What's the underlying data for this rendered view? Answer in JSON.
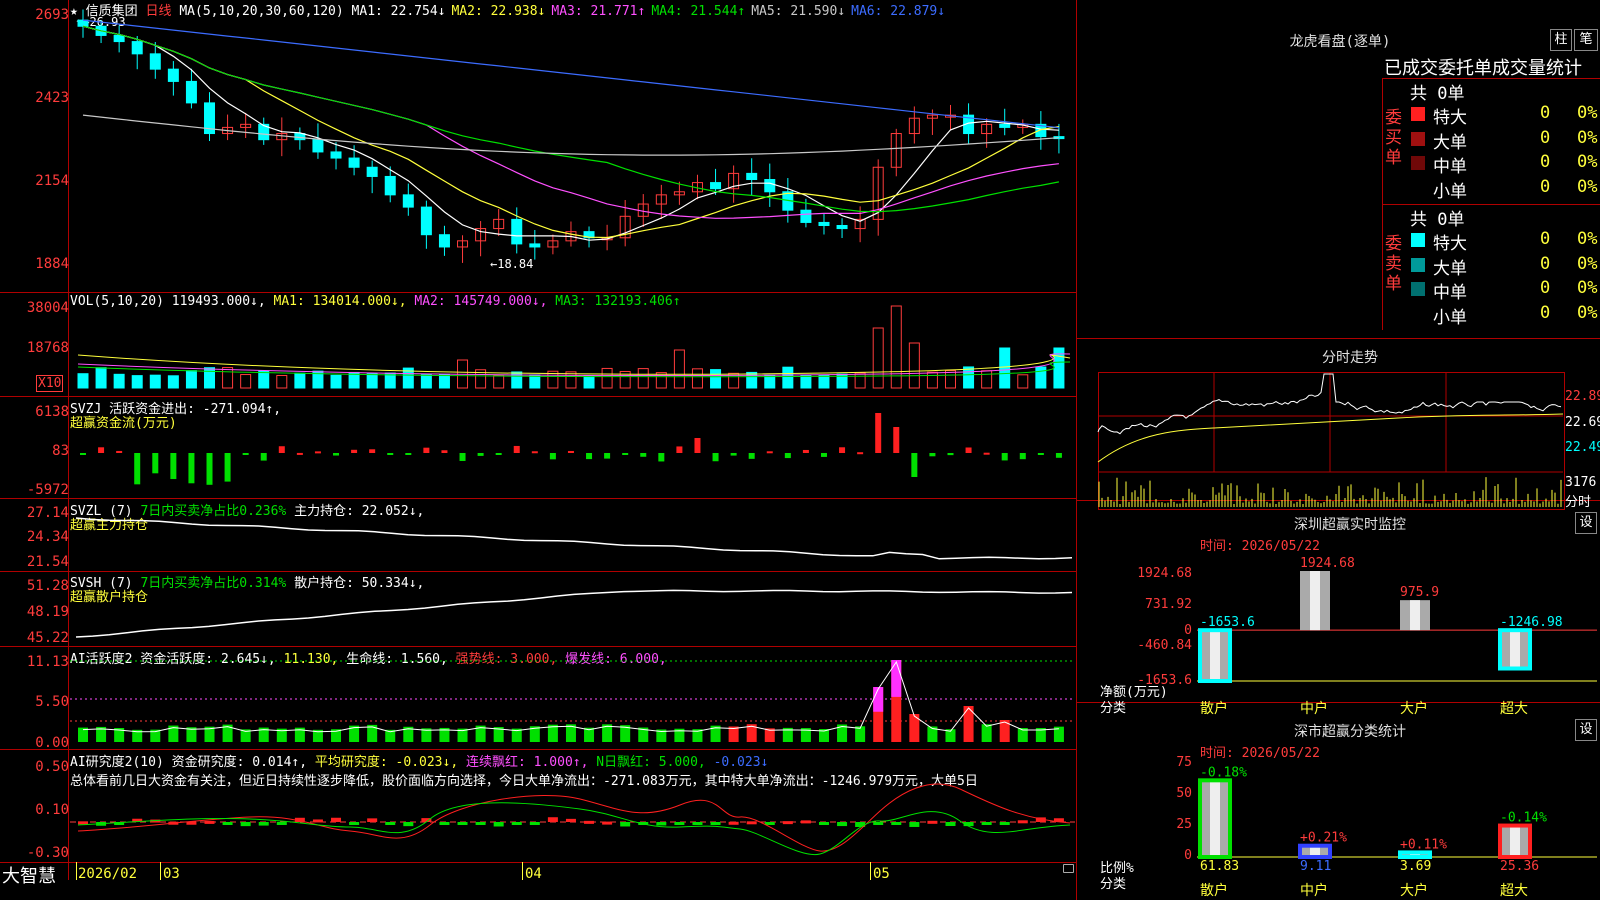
{
  "stock": {
    "star": "★",
    "name": "信质集团",
    "period": "日线"
  },
  "ma_legend": {
    "label": "MA(5,10,20,30,60,120)",
    "items": [
      {
        "name": "MA1:",
        "value": "22.754",
        "arrow": "↓",
        "color": "#ffffff"
      },
      {
        "name": "MA2:",
        "value": "22.938",
        "arrow": "↓",
        "color": "#ffff3c"
      },
      {
        "name": "MA3:",
        "value": "21.771",
        "arrow": "↑",
        "color": "#ff50ff"
      },
      {
        "name": "MA4:",
        "value": "21.544",
        "arrow": "↑",
        "color": "#00e000"
      },
      {
        "name": "MA5:",
        "value": "21.590",
        "arrow": "↓",
        "color": "#c8c8c8"
      },
      {
        "name": "MA6:",
        "value": "22.879",
        "arrow": "↓",
        "color": "#3c6cff"
      }
    ]
  },
  "price_axis": [
    "2693",
    "2423",
    "2154",
    "1884"
  ],
  "annot_high": "26.93",
  "annot_low": "←18.84",
  "vol": {
    "axis": [
      "38004",
      "18768"
    ],
    "x10": "X10",
    "head": "VOL(5,10,20)",
    "value": "119493.000",
    "ma1": "MA1: 134014.000↓,",
    "ma2": "MA2: 145749.000↓,",
    "ma3": "MA3: 132193.406↑"
  },
  "svzj": {
    "axis": [
      "6138",
      "83",
      "-5972"
    ],
    "head": "SVZJ  活跃资金进出: -271.094↑,",
    "sub": "超赢资金流(万元)"
  },
  "svzl": {
    "axis": [
      "27.14",
      "24.34",
      "21.54"
    ],
    "head1": "SVZL (7)",
    "head2": "7日内买卖净占比0.236%",
    "head3": "主力持仓: 22.052↓,",
    "sub": "超赢主力持仓"
  },
  "svsh": {
    "axis": [
      "51.28",
      "48.19",
      "45.22"
    ],
    "head1": "SVSH (7)",
    "head2": "7日内买卖净占比0.314%",
    "head3": "散户持仓: 50.334↓,",
    "sub": "超赢散户持仓"
  },
  "ai_active": {
    "axis": [
      "11.13",
      "5.50",
      "0.00"
    ],
    "h1": "AI活跃度2 资金活跃度: 2.645↓,",
    "h2": "11.130,",
    "h3": "生命线: 1.560,",
    "h4": "强势线: 3.000,",
    "h5": "爆发线: 6.000,"
  },
  "ai_research": {
    "axis": [
      "0.50",
      "0.10",
      "-0.30"
    ],
    "h1": "AI研究度2(10) 资金研究度: 0.014↑,",
    "h2": "平均研究度: -0.023↓,",
    "h3": "连续飘红: 1.000↑,",
    "h4": "N日飘红: 5.000,",
    "h5": "-0.023↓",
    "summary": "总体看前几日大资金有关注，但近日持续性逐步降低，股价面临方向选择，今日大单净流出：-271.083万元，其中特大单净流出：-1246.979万元，大单5日"
  },
  "footer": {
    "brand": "大智慧",
    "dates": [
      "2026/02",
      "03",
      "04",
      "05"
    ]
  },
  "dragon": {
    "title": "龙虎看盘(逐单)",
    "btn1": "柱",
    "btn2": "笔",
    "heading": "已成交委托单成交量统计",
    "buy_label": "委买单",
    "sell_label": "委卖单",
    "buy_total": "共 0单",
    "sell_total": "共 0单",
    "buy_rows": [
      {
        "label": "特大",
        "count": "0",
        "pct": "0%",
        "color": "#ff2020"
      },
      {
        "label": "大单",
        "count": "0",
        "pct": "0%",
        "color": "#a01010"
      },
      {
        "label": "中单",
        "count": "0",
        "pct": "0%",
        "color": "#700808"
      },
      {
        "label": "小单",
        "count": "0",
        "pct": "0%",
        "color": "#000000"
      }
    ],
    "sell_rows": [
      {
        "label": "特大",
        "count": "0",
        "pct": "0%",
        "color": "#00ffff"
      },
      {
        "label": "大单",
        "count": "0",
        "pct": "0%",
        "color": "#009a9a"
      },
      {
        "label": "中单",
        "count": "0",
        "pct": "0%",
        "color": "#007070"
      },
      {
        "label": "小单",
        "count": "0",
        "pct": "0%",
        "color": "#000000"
      }
    ]
  },
  "intraday": {
    "title": "分时走势",
    "axis": [
      "22.89",
      "22.69",
      "22.49"
    ],
    "vol_axis": "3176",
    "vol_unit": "分时"
  },
  "monitor": {
    "title": "深圳超赢实时监控",
    "btn": "设",
    "time": "时间: 2026/05/22",
    "axis": [
      "1924.68",
      "731.92",
      "0",
      "-460.84",
      "-1653.6"
    ],
    "ylabel1": "净额(万元)",
    "ylabel2": "分类",
    "categories": [
      "散户",
      "中户",
      "大户",
      "超大"
    ],
    "values": [
      -1653.6,
      1924.68,
      975.9,
      -1246.98
    ],
    "labels": [
      "-1653.6",
      "1924.68",
      "975.9",
      "-1246.98"
    ]
  },
  "classify": {
    "title": "深市超赢分类统计",
    "btn": "设",
    "time": "时间: 2026/05/22",
    "axis": [
      "75",
      "50",
      "25",
      "0"
    ],
    "ylabel1": "比例%",
    "ylabel2": "分类",
    "categories": [
      "散户",
      "中户",
      "大户",
      "超大"
    ],
    "values": [
      61.83,
      9.11,
      3.69,
      25.36
    ],
    "values_text": [
      "61.83",
      "9.11",
      "3.69",
      "25.36"
    ],
    "changes": [
      "-0.18%",
      "+0.21%",
      "+0.11%",
      "-0.14%"
    ]
  },
  "chart_data": [
    {
      "type": "bar",
      "title": "深圳超赢实时监控",
      "ylabel": "净额(万元)",
      "xlabel": "分类",
      "categories": [
        "散户",
        "中户",
        "大户",
        "超大"
      ],
      "values": [
        -1653.6,
        1924.68,
        975.9,
        -1246.98
      ],
      "ylim": [
        -1653.6,
        1924.68
      ]
    },
    {
      "type": "bar",
      "title": "深市超赢分类统计",
      "ylabel": "比例%",
      "xlabel": "分类",
      "categories": [
        "散户",
        "中户",
        "大户",
        "超大"
      ],
      "values": [
        61.83,
        9.11,
        3.69,
        25.36
      ],
      "ylim": [
        0,
        75
      ]
    }
  ]
}
